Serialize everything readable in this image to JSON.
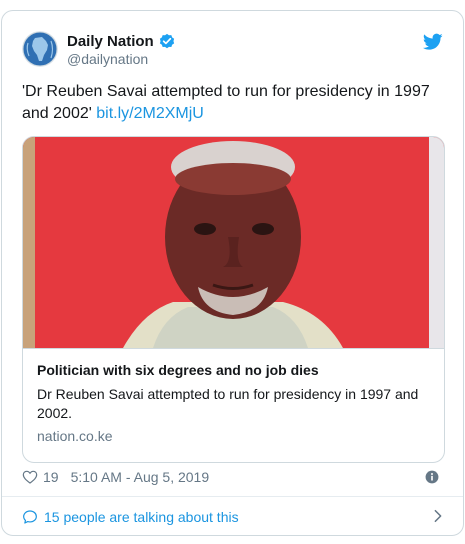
{
  "author": {
    "name": "Daily Nation",
    "handle": "@dailynation",
    "avatar_icon": "globe-africa-logo",
    "verified_icon": "verified-badge-icon",
    "brand_icon": "twitter-bird-icon"
  },
  "tweet": {
    "text": "'Dr Reuben Savai attempted to run for presidency in 1997 and 2002'",
    "link": "bit.ly/2M2XMjU"
  },
  "link_card": {
    "image_alt": "portrait-photo",
    "title": "Politician with six degrees and no job dies",
    "description": "Dr Reuben Savai attempted to run for presidency in 1997 and 2002.",
    "domain": "nation.co.ke"
  },
  "meta": {
    "like_count": "19",
    "timestamp": "5:10 AM - Aug 5, 2019",
    "like_icon": "heart-icon",
    "info_icon": "info-icon"
  },
  "conversation": {
    "text": "15 people are talking about this",
    "icon": "speech-bubble-icon",
    "chevron_icon": "chevron-right-icon"
  },
  "colors": {
    "link": "#1b95e0",
    "muted": "#657786",
    "text": "#14171a",
    "photo_background": "#e23c40",
    "verified": "#1da1f2"
  }
}
